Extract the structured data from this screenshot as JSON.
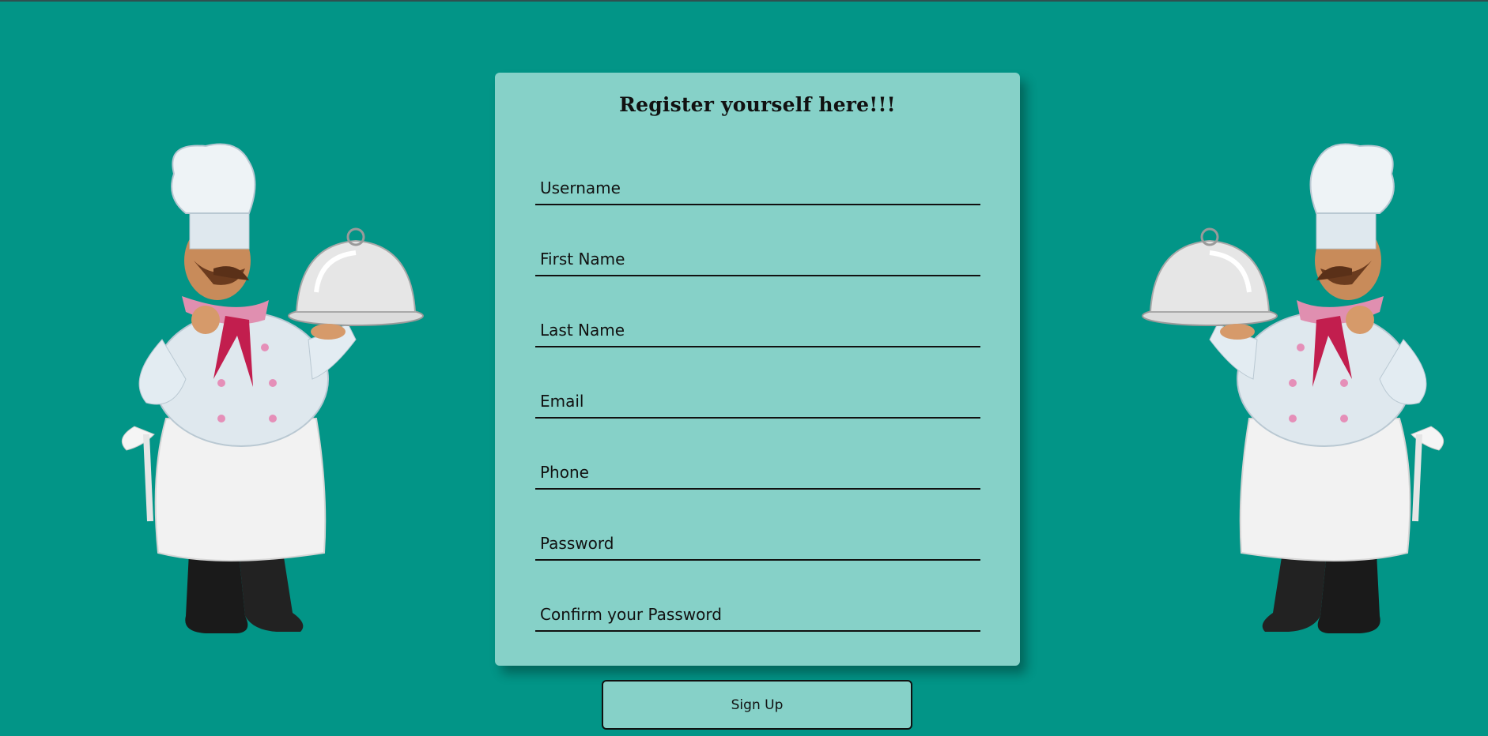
{
  "form": {
    "title": "Register yourself here!!!",
    "fields": [
      {
        "name": "username",
        "placeholder": "Username",
        "value": ""
      },
      {
        "name": "first-name",
        "placeholder": "First Name",
        "value": ""
      },
      {
        "name": "last-name",
        "placeholder": "Last Name",
        "value": ""
      },
      {
        "name": "email",
        "placeholder": "Email",
        "value": ""
      },
      {
        "name": "phone",
        "placeholder": "Phone",
        "value": ""
      },
      {
        "name": "password",
        "placeholder": "Password",
        "value": ""
      },
      {
        "name": "confirm-password",
        "placeholder": "Confirm your Password",
        "value": ""
      }
    ],
    "submit_label": "Sign Up"
  },
  "illustrations": {
    "left": "chef-holding-cloche-icon",
    "right": "chef-holding-cloche-icon"
  },
  "colors": {
    "background": "#029587",
    "card": "#86d1c8",
    "text": "#111111"
  }
}
